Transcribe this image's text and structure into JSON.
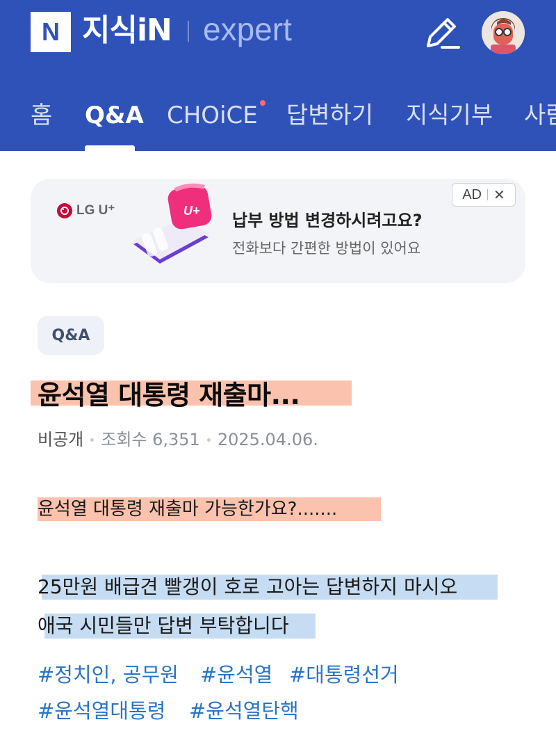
{
  "header": {
    "logo_letter": "N",
    "brand": "지식iN",
    "expert": "expert",
    "tabs": [
      {
        "label": "홈"
      },
      {
        "label": "Q&A"
      },
      {
        "label": "CHOiCE"
      },
      {
        "label": "답변하기"
      },
      {
        "label": "지식기부"
      },
      {
        "label": "사람"
      }
    ],
    "active_tab": "Q&A",
    "accent_color": "#2f52b9"
  },
  "ad": {
    "brand": "LG U⁺",
    "title": "납부 방법 변경하시려고요?",
    "subtitle": "전화보다 간편한 방법이 있어요",
    "badge": "AD",
    "close": "✕"
  },
  "post": {
    "category": "Q&A",
    "title": "윤석열 대통령 재출마...",
    "author": "비공개",
    "views": "조회수 6,351",
    "date": "2025.04.06.",
    "question": "윤석열 대통령 재출마 가능한가요?.......",
    "body_line1": "25만원 배급견 빨갱이 호로 고아는 답변하지 마시오",
    "body_line2": "애국 시민들만 답변 부탁합니다",
    "tags": [
      "#정치인, 공무원",
      "#윤석열",
      "#대통령선거",
      "#윤석열대통령",
      "#윤석열탄핵"
    ]
  }
}
